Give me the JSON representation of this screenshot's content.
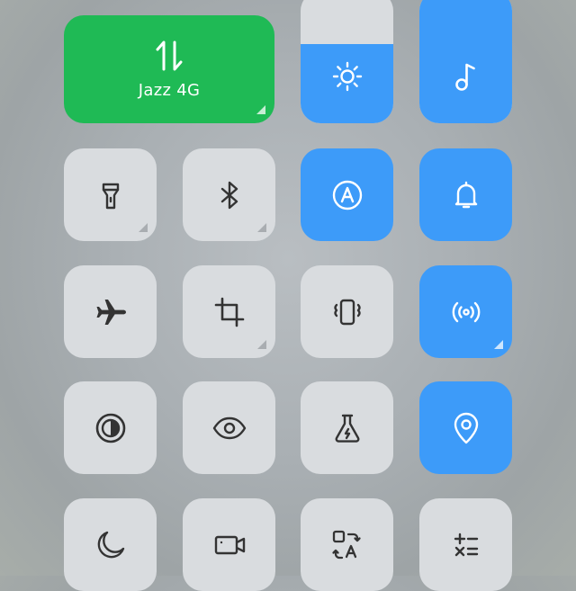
{
  "mobile_data": {
    "label": "Jazz 4G",
    "icon": "data-arrows-icon",
    "color": "#1fba55"
  },
  "brightness": {
    "icon": "sun-icon",
    "level": 0.6
  },
  "volume": {
    "icon": "music-note-icon",
    "level": 1.0
  },
  "accent_color": "#3d9bf9",
  "tiles": [
    {
      "name": "flashlight",
      "icon": "flashlight-icon",
      "active": false,
      "has_menu": true
    },
    {
      "name": "bluetooth",
      "icon": "bluetooth-icon",
      "active": false,
      "has_menu": true
    },
    {
      "name": "auto-brightness",
      "icon": "auto-brightness-icon",
      "active": true,
      "has_menu": false
    },
    {
      "name": "sound",
      "icon": "bell-icon",
      "active": true,
      "has_menu": false
    },
    {
      "name": "airplane-mode",
      "icon": "airplane-icon",
      "active": false,
      "has_menu": false
    },
    {
      "name": "screenshot",
      "icon": "crop-icon",
      "active": false,
      "has_menu": true
    },
    {
      "name": "vibrate",
      "icon": "vibrate-icon",
      "active": false,
      "has_menu": false
    },
    {
      "name": "hotspot",
      "icon": "hotspot-icon",
      "active": true,
      "has_menu": true
    },
    {
      "name": "dark-mode",
      "icon": "contrast-icon",
      "active": false,
      "has_menu": false
    },
    {
      "name": "reading-mode",
      "icon": "eye-icon",
      "active": false,
      "has_menu": false
    },
    {
      "name": "battery-saver",
      "icon": "flask-icon",
      "active": false,
      "has_menu": false
    },
    {
      "name": "location",
      "icon": "location-pin-icon",
      "active": true,
      "has_menu": false
    },
    {
      "name": "do-not-disturb",
      "icon": "moon-icon",
      "active": false,
      "has_menu": false
    },
    {
      "name": "screen-recorder",
      "icon": "video-camera-icon",
      "active": false,
      "has_menu": false
    },
    {
      "name": "translate",
      "icon": "translate-icon",
      "active": false,
      "has_menu": false
    },
    {
      "name": "calculator",
      "icon": "calculator-icon",
      "active": false,
      "has_menu": false
    }
  ]
}
